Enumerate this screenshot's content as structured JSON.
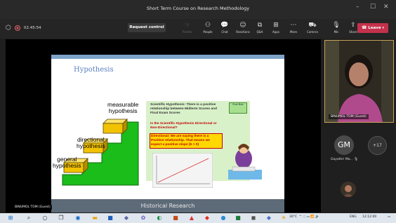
{
  "window": {
    "title": "Short Term Course on Research Methodology",
    "minimize": "–",
    "maximize": "☐",
    "close": "✕"
  },
  "toolbar": {
    "timer": "02:45:54",
    "request_control": "Request control",
    "tools": [
      {
        "label": "Pointer",
        "glyph": "☞",
        "disabled": true
      },
      {
        "label": "People",
        "glyph": "⚇",
        "disabled": false
      },
      {
        "label": "Chat",
        "glyph": "💬",
        "disabled": false
      },
      {
        "label": "Reactions",
        "glyph": "☺",
        "disabled": false
      },
      {
        "label": "Q&A",
        "glyph": "⧉",
        "disabled": false
      },
      {
        "label": "Apps",
        "glyph": "⊞",
        "disabled": false
      },
      {
        "label": "More",
        "glyph": "⋯",
        "disabled": false
      },
      {
        "label": "Camera",
        "glyph": "⛟",
        "disabled": false
      },
      {
        "label": "Mic",
        "glyph": "🎙",
        "disabled": false
      },
      {
        "label": "Share",
        "glyph": "⇪",
        "disabled": false
      }
    ],
    "leave": "Leave"
  },
  "slide": {
    "title": "Hypothesis",
    "steps": [
      "general hypothesis",
      "directional hypothesis",
      "measurable hypothesis"
    ],
    "steps_lines": {
      "s1a": "general",
      "s1b": "hypothesis",
      "s2a": "directional",
      "s2b": "hypothesis",
      "s3a": "measurable",
      "s3b": "hypothesis"
    },
    "scientific": "Scientific Hypothesis: There is a positive relationship between Midterm Scores and Final Exam Scores",
    "question": "Is the Scientific Hypothesis Directional or Non-Directional?",
    "answer": "Directional: We are saying there is a Positive relationship. That means we expect a positive slope (b > 0)",
    "badge": "Free Bee"
  },
  "footer_slide": "Historical Research",
  "presenter": {
    "name": "BINUMOL TOM (Guest)"
  },
  "participants": [
    {
      "initials": "GM",
      "name": "Gayathri Ma..."
    }
  ],
  "more_count": "+17",
  "local_name": "BINUMOL TOM (Guest)",
  "taskbar": {
    "temp": "30°C",
    "lang": "ENG",
    "time": "12:12:00"
  },
  "colors": {
    "leave": "#c4314b",
    "accent": "#c9a25a",
    "record": "#e05f6a"
  }
}
